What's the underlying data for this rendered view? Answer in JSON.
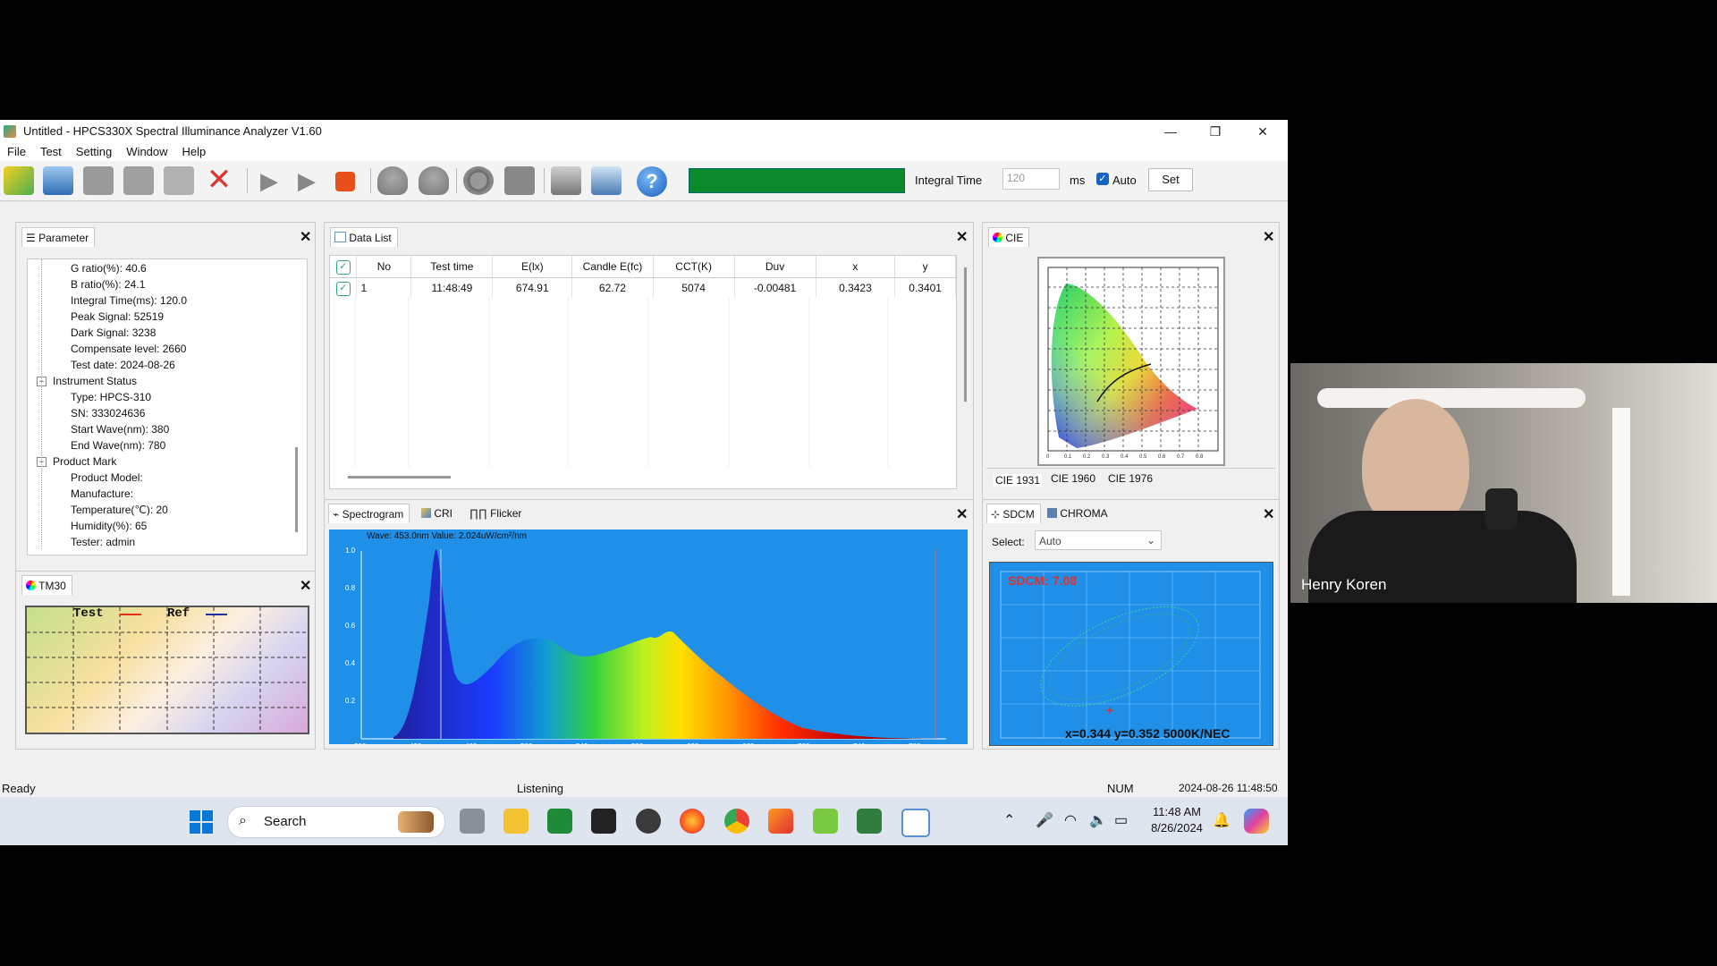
{
  "window": {
    "title": "Untitled - HPCS330X Spectral Illuminance Analyzer V1.60",
    "min": "—",
    "max": "❐",
    "close": "✕"
  },
  "menu": [
    "File",
    "Test",
    "Setting",
    "Window",
    "Help"
  ],
  "toolbar": {
    "integral_label": "Integral Time",
    "integral_value": "120",
    "unit": "ms",
    "auto_label": "Auto",
    "set_label": "Set"
  },
  "parameter": {
    "tab": "Parameter",
    "items": [
      "G ratio(%): 40.6",
      "B ratio(%): 24.1",
      "Integral Time(ms): 120.0",
      "Peak Signal: 52519",
      "Dark Signal: 3238",
      "Compensate level: 2660",
      "Test date: 2024-08-26"
    ],
    "group_instrument": "Instrument Status",
    "instrument": [
      "Type: HPCS-310",
      "SN: 333024636",
      "Start Wave(nm): 380",
      "End Wave(nm): 780"
    ],
    "group_product": "Product Mark",
    "product": [
      "Product Model:",
      "Manufacture:",
      "Temperature(℃): 20",
      "Humidity(%): 65",
      "Tester: admin"
    ]
  },
  "tm30": {
    "tab": "TM30",
    "legend_test": "Test",
    "legend_ref": "Ref"
  },
  "datalist": {
    "tab": "Data List",
    "columns": [
      "No",
      "Test time",
      "E(lx)",
      "Candle E(fc)",
      "CCT(K)",
      "Duv",
      "x",
      "y"
    ],
    "rows": [
      [
        "1",
        "11:48:49",
        "674.91",
        "62.72",
        "5074",
        "-0.00481",
        "0.3423",
        "0.3401"
      ]
    ]
  },
  "cie": {
    "tab": "CIE",
    "tabs": [
      "CIE 1931",
      "CIE 1960",
      "CIE 1976"
    ],
    "ticks": [
      "0",
      "0.1",
      "0.2",
      "0.3",
      "0.4",
      "0.5",
      "0.6",
      "0.7",
      "0.8"
    ]
  },
  "spectrum": {
    "tabs": [
      "Spectrogram",
      "CRI",
      "Flicker"
    ],
    "readout": "Wave: 453.0nm Value: 2.024uW/cm²/nm",
    "yticks": [
      "1.0",
      "0.8",
      "0.6",
      "0.4",
      "0.2"
    ],
    "xticks": [
      "380",
      "420",
      "460",
      "500",
      "540",
      "580",
      "620",
      "660",
      "700",
      "740",
      "780"
    ]
  },
  "sdcm": {
    "tabs": [
      "SDCM",
      "CHROMA"
    ],
    "select_label": "Select:",
    "select_value": "Auto",
    "value": "SDCM: 7.08",
    "coords": "x=0.344 y=0.352 5000K/NEC"
  },
  "status": {
    "ready": "Ready",
    "listening": "Listening",
    "num": "NUM",
    "datetime": "2024-08-26 11:48:50"
  },
  "taskbar": {
    "search": "Search",
    "time": "11:48 AM",
    "date": "8/26/2024"
  },
  "video": {
    "name": "Henry Koren"
  },
  "colors": {
    "progress": "#0a8a2a",
    "plot_bg": "#1f8fe8",
    "accent": "#1565c0"
  }
}
